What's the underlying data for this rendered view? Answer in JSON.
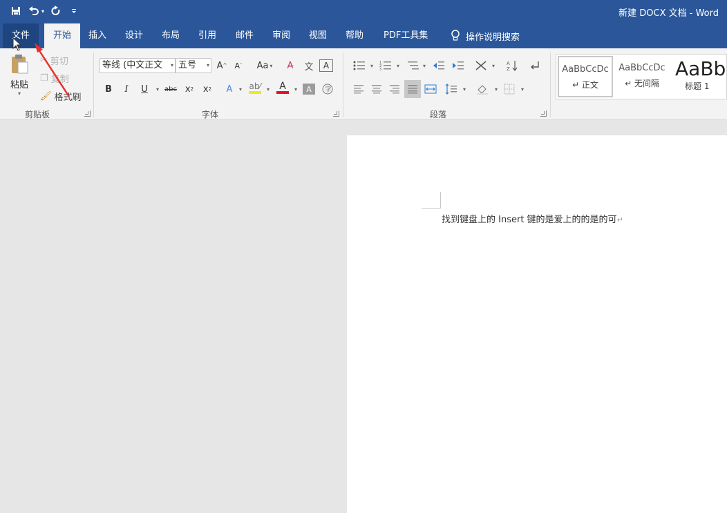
{
  "window": {
    "title": "新建 DOCX 文档 - Word"
  },
  "qat": {
    "save_icon": "save-icon",
    "undo_icon": "undo-icon",
    "redo_icon": "redo-icon",
    "customize_icon": "customize-qat-icon"
  },
  "tabs": [
    {
      "label": "文件"
    },
    {
      "label": "开始"
    },
    {
      "label": "插入"
    },
    {
      "label": "设计"
    },
    {
      "label": "布局"
    },
    {
      "label": "引用"
    },
    {
      "label": "邮件"
    },
    {
      "label": "审阅"
    },
    {
      "label": "视图"
    },
    {
      "label": "帮助"
    },
    {
      "label": "PDF工具集"
    }
  ],
  "tell_me": {
    "label": "操作说明搜索"
  },
  "clipboard": {
    "paste_label": "粘贴",
    "cut_label": "剪切",
    "copy_label": "复制",
    "format_painter_label": "格式刷",
    "group_label": "剪贴板"
  },
  "font": {
    "font_name": "等线 (中文正文",
    "font_size": "五号",
    "grow": "A",
    "shrink": "A",
    "change_case": "Aa",
    "bold": "B",
    "italic": "I",
    "underline": "U",
    "strike": "abc",
    "subscript": "x",
    "superscript": "x",
    "text_effect": "A",
    "font_color": "A",
    "char_shading": "A",
    "group_label": "字体"
  },
  "paragraph": {
    "sort": "↓",
    "group_label": "段落"
  },
  "styles": {
    "items": [
      {
        "preview": "AaBbCcDc",
        "name": "↵ 正文"
      },
      {
        "preview": "AaBbCcDc",
        "name": "↵ 无间隔"
      },
      {
        "preview": "AaBb",
        "name": "标题 1"
      }
    ]
  },
  "document": {
    "text": "找到键盘上的 Insert 键的是爱上的的是的可",
    "para_mark": "↵"
  },
  "colors": {
    "title_bar": "#2b579a",
    "ribbon": "#f3f3f3",
    "highlight_yellow": "#f5e51c",
    "font_red": "#e81123",
    "annotation_red": "#e8312a"
  }
}
